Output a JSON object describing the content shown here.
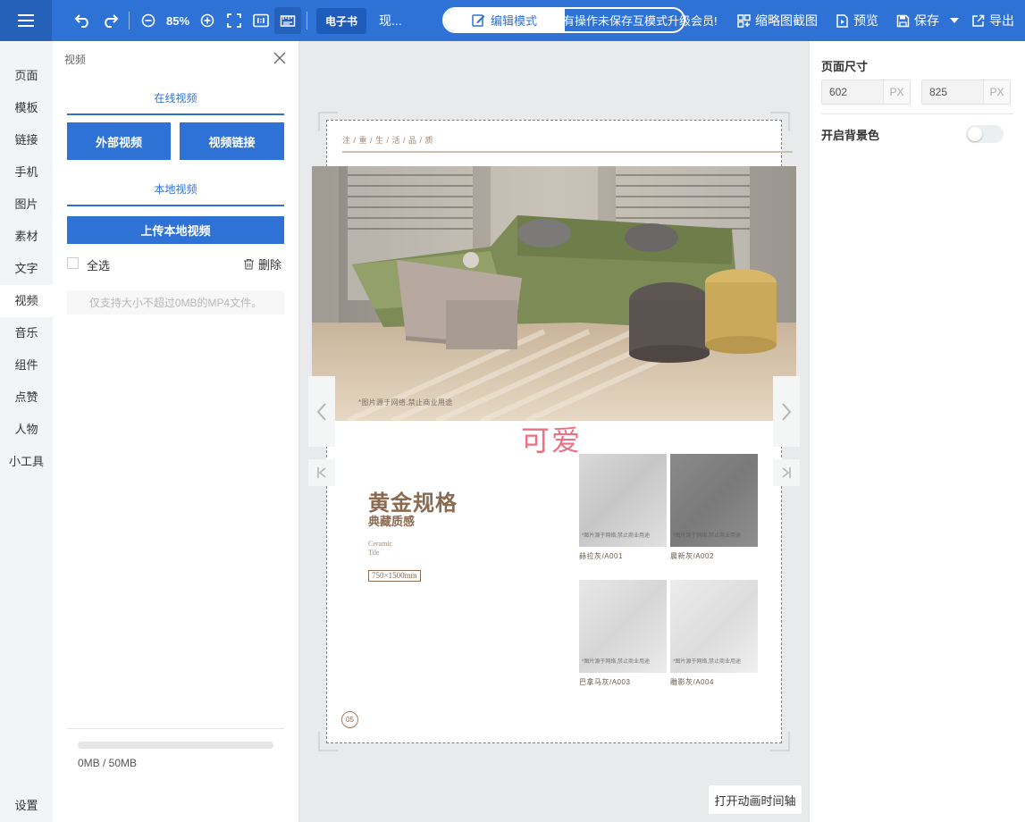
{
  "toolbar": {
    "zoom": "85%",
    "ebook_tag": "电子书",
    "doc_name": "现...",
    "mode_label": "编辑模式",
    "mode_right_text": "有操作未保存",
    "notice": "有操作未保存互模式升级会员!",
    "actions": {
      "screenshot": "缩略图截图",
      "preview": "预览",
      "save": "保存",
      "export": "导出"
    }
  },
  "left_nav": {
    "items": [
      "页面",
      "模板",
      "链接",
      "手机",
      "图片",
      "素材",
      "文字",
      "视频",
      "音乐",
      "组件",
      "点赞",
      "人物",
      "小工具"
    ],
    "active_index": 7,
    "settings": "设置"
  },
  "video_panel": {
    "title": "视频",
    "online_section": "在线视频",
    "external_video_button": "外部视频",
    "video_link_button": "视频链接",
    "local_section": "本地视频",
    "upload_button": "上传本地视频",
    "select_all": "全选",
    "delete": "删除",
    "hint": "仅支持大小不超过0MB的MP4文件。",
    "usage": "0MB / 50MB",
    "usage_fraction": 0
  },
  "page": {
    "tagline": "注 / 重 / 生 / 活 / 品 / 质",
    "photo_note": "*图片源于网络,禁止商业用途",
    "cute_text": "可爱",
    "heading": "黄金规格",
    "subheading": "典藏质感",
    "english_line1": "Ceramic",
    "english_line2": "Tile",
    "size": "750×1500mm",
    "page_number": "05",
    "tiles": [
      {
        "label": "赫拉灰/A001",
        "note": "*图片源于网络,禁止商业用途"
      },
      {
        "label": "晨新灰/A002",
        "note": "*图片源于网络,禁止商业用途"
      },
      {
        "label": "巴拿马灰/A003",
        "note": "*图片源于网络,禁止商业用途"
      },
      {
        "label": "雕影灰/A004",
        "note": "*图片源于网络,禁止商业用途"
      }
    ]
  },
  "canvas": {
    "timeline_button": "打开动画时间轴"
  },
  "right_panel": {
    "page_size_title": "页面尺寸",
    "width": "602",
    "height": "825",
    "unit": "PX",
    "bg_color_label": "开启背景色",
    "bg_color_enabled": false
  },
  "colors": {
    "primary": "#2f72d6",
    "accent_pink": "#ee6f82",
    "brown": "#8b6a52"
  }
}
